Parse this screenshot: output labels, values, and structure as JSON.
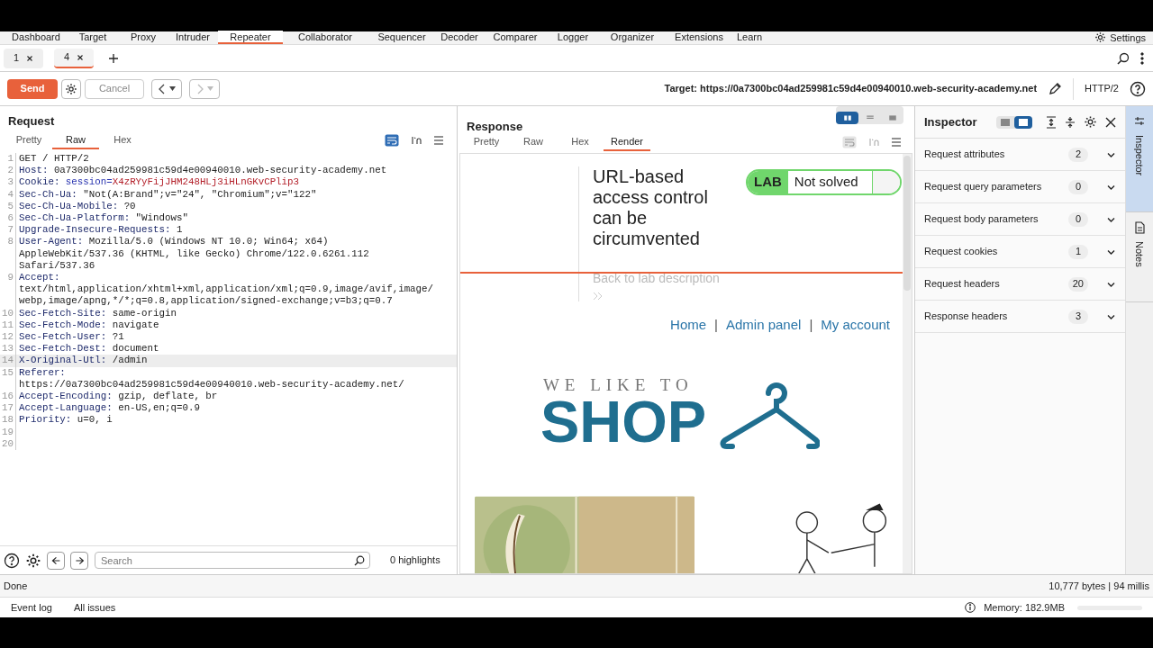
{
  "nav": {
    "tabs": [
      {
        "label": "Dashboard",
        "selected": false
      },
      {
        "label": "Target",
        "selected": false
      },
      {
        "label": "Proxy",
        "selected": false
      },
      {
        "label": "Intruder",
        "selected": false
      },
      {
        "label": "Repeater",
        "selected": true
      },
      {
        "label": "Collaborator",
        "selected": false
      },
      {
        "label": "Sequencer",
        "selected": false
      },
      {
        "label": "Decoder",
        "selected": false
      },
      {
        "label": "Comparer",
        "selected": false
      },
      {
        "label": "Logger",
        "selected": false
      },
      {
        "label": "Organizer",
        "selected": false
      },
      {
        "label": "Extensions",
        "selected": false
      },
      {
        "label": "Learn",
        "selected": false
      }
    ],
    "settings": "Settings"
  },
  "repeater_tabs": [
    {
      "label": "1",
      "selected": false
    },
    {
      "label": "4",
      "selected": true
    }
  ],
  "toolbar": {
    "send": "Send",
    "cancel": "Cancel",
    "target": "Target: https://0a7300bc04ad259981c59d4e00940010.web-security-academy.net",
    "protocol": "HTTP/2"
  },
  "request": {
    "title": "Request",
    "tabs": [
      {
        "label": "Pretty",
        "selected": false
      },
      {
        "label": "Raw",
        "selected": true
      },
      {
        "label": "Hex",
        "selected": false
      }
    ],
    "lines": [
      {
        "number": "1",
        "highlighted": false,
        "parts": [
          {
            "kind": "plain",
            "text": "GET / HTTP/2"
          }
        ]
      },
      {
        "number": "2",
        "highlighted": false,
        "parts": [
          {
            "kind": "name",
            "text": "Host:"
          },
          {
            "kind": "plain",
            "text": " 0a7300bc04ad259981c59d4e00940010.web-security-academy.net"
          }
        ]
      },
      {
        "number": "3",
        "highlighted": false,
        "parts": [
          {
            "kind": "name",
            "text": "Cookie:"
          },
          {
            "kind": "param",
            "text": " session="
          },
          {
            "kind": "cookie",
            "text": "X4zRYyFijJHM248HLj3iHLnGKvCPlip3"
          }
        ]
      },
      {
        "number": "4",
        "highlighted": false,
        "parts": [
          {
            "kind": "name",
            "text": "Sec-Ch-Ua:"
          },
          {
            "kind": "plain",
            "text": " \"Not(A:Brand\";v=\"24\", \"Chromium\";v=\"122\""
          }
        ]
      },
      {
        "number": "5",
        "highlighted": false,
        "parts": [
          {
            "kind": "name",
            "text": "Sec-Ch-Ua-Mobile:"
          },
          {
            "kind": "plain",
            "text": " ?0"
          }
        ]
      },
      {
        "number": "6",
        "highlighted": false,
        "parts": [
          {
            "kind": "name",
            "text": "Sec-Ch-Ua-Platform:"
          },
          {
            "kind": "plain",
            "text": " \"Windows\""
          }
        ]
      },
      {
        "number": "7",
        "highlighted": false,
        "parts": [
          {
            "kind": "name",
            "text": "Upgrade-Insecure-Requests:"
          },
          {
            "kind": "plain",
            "text": " 1"
          }
        ]
      },
      {
        "number": "8",
        "highlighted": false,
        "parts": [
          {
            "kind": "name",
            "text": "User-Agent:"
          },
          {
            "kind": "plain",
            "text": " Mozilla/5.0 (Windows NT 10.0; Win64; x64)"
          }
        ],
        "wrapped": [
          "AppleWebKit/537.36 (KHTML, like Gecko) Chrome/122.0.6261.112",
          "Safari/537.36"
        ]
      },
      {
        "number": "9",
        "highlighted": false,
        "parts": [
          {
            "kind": "name",
            "text": "Accept:"
          }
        ],
        "wrapped": [
          "text/html,application/xhtml+xml,application/xml;q=0.9,image/avif,image/",
          "webp,image/apng,*/*;q=0.8,application/signed-exchange;v=b3;q=0.7"
        ]
      },
      {
        "number": "10",
        "highlighted": false,
        "parts": [
          {
            "kind": "name",
            "text": "Sec-Fetch-Site:"
          },
          {
            "kind": "plain",
            "text": " same-origin"
          }
        ]
      },
      {
        "number": "11",
        "highlighted": false,
        "parts": [
          {
            "kind": "name",
            "text": "Sec-Fetch-Mode:"
          },
          {
            "kind": "plain",
            "text": " navigate"
          }
        ]
      },
      {
        "number": "12",
        "highlighted": false,
        "parts": [
          {
            "kind": "name",
            "text": "Sec-Fetch-User:"
          },
          {
            "kind": "plain",
            "text": " ?1"
          }
        ]
      },
      {
        "number": "13",
        "highlighted": false,
        "parts": [
          {
            "kind": "name",
            "text": "Sec-Fetch-Dest:"
          },
          {
            "kind": "plain",
            "text": " document"
          }
        ]
      },
      {
        "number": "14",
        "highlighted": true,
        "parts": [
          {
            "kind": "name",
            "text": "X-Original-Utl:"
          },
          {
            "kind": "plain",
            "text": " /admin"
          }
        ]
      },
      {
        "number": "15",
        "highlighted": false,
        "parts": [
          {
            "kind": "name",
            "text": "Referer:"
          }
        ],
        "wrapped": [
          "https://0a7300bc04ad259981c59d4e00940010.web-security-academy.net/"
        ]
      },
      {
        "number": "16",
        "highlighted": false,
        "parts": [
          {
            "kind": "name",
            "text": "Accept-Encoding:"
          },
          {
            "kind": "plain",
            "text": " gzip, deflate, br"
          }
        ]
      },
      {
        "number": "17",
        "highlighted": false,
        "parts": [
          {
            "kind": "name",
            "text": "Accept-Language:"
          },
          {
            "kind": "plain",
            "text": " en-US,en;q=0.9"
          }
        ]
      },
      {
        "number": "18",
        "highlighted": false,
        "parts": [
          {
            "kind": "name",
            "text": "Priority:"
          },
          {
            "kind": "plain",
            "text": " u=0, i"
          }
        ]
      },
      {
        "number": "19",
        "highlighted": false
      },
      {
        "number": "20",
        "highlighted": false
      }
    ],
    "search": {
      "placeholder": "Search"
    },
    "highlights": "0 highlights"
  },
  "response": {
    "title": "Response",
    "tabs": [
      {
        "label": "Pretty",
        "selected": false
      },
      {
        "label": "Raw",
        "selected": false
      },
      {
        "label": "Hex",
        "selected": false
      },
      {
        "label": "Render",
        "selected": true
      }
    ],
    "render": {
      "lab_title": "URL-based access control can be circumvented",
      "lab_badge": "LAB",
      "lab_status": "Not solved",
      "back_link": "Back to lab description",
      "nav_links": [
        {
          "kind": "link",
          "text": "Home"
        },
        {
          "kind": "separator",
          "text": "|"
        },
        {
          "kind": "link",
          "text": "Admin panel"
        },
        {
          "kind": "separator",
          "text": "|"
        },
        {
          "kind": "link",
          "text": "My account"
        }
      ],
      "logo_top": "WE LIKE TO",
      "logo_main": "SHOP"
    }
  },
  "inspector": {
    "title": "Inspector",
    "sections": [
      {
        "label": "Request attributes",
        "count": "2"
      },
      {
        "label": "Request query parameters",
        "count": "0"
      },
      {
        "label": "Request body parameters",
        "count": "0"
      },
      {
        "label": "Request cookies",
        "count": "1"
      },
      {
        "label": "Request headers",
        "count": "20"
      },
      {
        "label": "Response headers",
        "count": "3"
      }
    ]
  },
  "side_tabs": [
    {
      "label": "Inspector",
      "selected": true
    },
    {
      "label": "Notes",
      "selected": false
    }
  ],
  "status": {
    "left": "Done",
    "right": "10,777 bytes | 94 millis"
  },
  "bottom": {
    "items": [
      "Event log",
      "All issues"
    ],
    "memory": "Memory: 182.9MB"
  }
}
